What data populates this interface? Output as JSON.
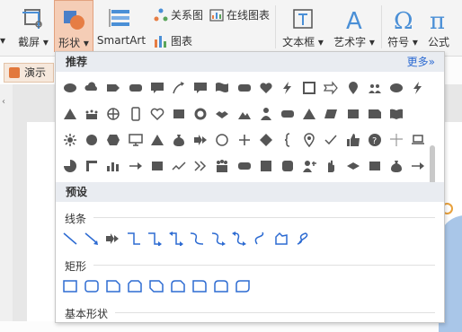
{
  "ribbon": {
    "screenshot_label": "截屏",
    "shapes_label": "形状",
    "smartart_label": "SmartArt",
    "relation_label": "关系图",
    "online_chart_label": "在线图表",
    "chart_label": "图表",
    "textbox_label": "文本框",
    "wordart_label": "艺术字",
    "symbol_label": "符号",
    "formula_label": "公式"
  },
  "doc_tab": {
    "label": "演示文"
  },
  "panel": {
    "recommended_title": "推荐",
    "more_label": "更多»",
    "preset_title": "预设",
    "categories": {
      "lines": "线条",
      "rect": "矩形",
      "basic": "基本形状"
    }
  },
  "icons": {
    "recommended_rows": [
      [
        "ellipse",
        "cloud",
        "pentagon-arrow",
        "rounded-rect",
        "callout",
        "curved-arrow",
        "callout",
        "wave-rect",
        "rounded-rect",
        "heart",
        "lightning",
        "frame",
        "notched-arrow",
        "location-pin",
        "people",
        "ellipse",
        "lightning"
      ],
      [
        "triangle",
        "crowd",
        "globe",
        "phone",
        "heart-outline",
        "rect",
        "ring",
        "handshake",
        "mountain",
        "person",
        "rounded-rect",
        "triangle",
        "parallelogram",
        "rect",
        "snip-rect",
        "book"
      ],
      [
        "sun",
        "circle",
        "hexagon",
        "monitor",
        "triangle",
        "money-bag",
        "double-arrow",
        "circle-outline",
        "plus",
        "diamond",
        "brace",
        "pin",
        "check",
        "thumbs-up",
        "question",
        "cross",
        "laptop"
      ],
      [
        "pie",
        "corner",
        "chart",
        "arrow-right",
        "rect",
        "trend",
        "double-chevron",
        "people-group",
        "rounded-rect",
        "square",
        "rounded-square",
        "person-add",
        "hand",
        "diamond-flat",
        "rect",
        "money-bag",
        "arrow-right"
      ]
    ],
    "line_shapes": [
      "line",
      "arrow",
      "double-arrow",
      "elbow",
      "elbow-arrow",
      "elbow-double-arrow",
      "curve",
      "curve-arrow",
      "curve-double-arrow",
      "freeform-curve",
      "freeform",
      "scribble"
    ],
    "rect_shapes": [
      "rectangle",
      "rounded-rectangle",
      "snip-single",
      "snip-same-side",
      "snip-diagonal",
      "snip-round",
      "round-single",
      "round-same-side",
      "round-diagonal"
    ]
  }
}
